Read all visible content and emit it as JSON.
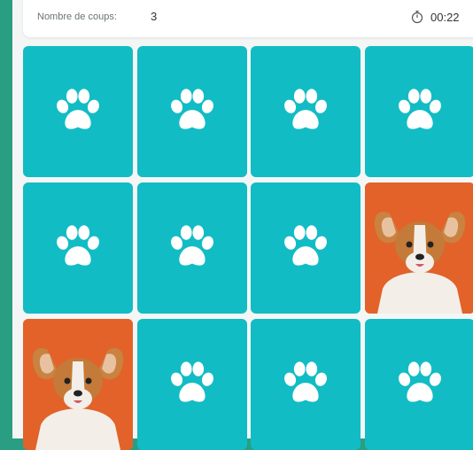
{
  "header": {
    "moves_label": "Nombre de coups:",
    "moves_value": "3",
    "timer_icon": "stopwatch-icon",
    "timer_value": "00:22"
  },
  "board": {
    "rows": 3,
    "cols": 4,
    "card_back_icon": "paw-icon",
    "card_back_color": "#12bcc4",
    "revealed_color": "#e2622a",
    "cards": [
      {
        "state": "hidden"
      },
      {
        "state": "hidden"
      },
      {
        "state": "hidden"
      },
      {
        "state": "hidden"
      },
      {
        "state": "hidden"
      },
      {
        "state": "hidden"
      },
      {
        "state": "hidden"
      },
      {
        "state": "revealed",
        "image": "corgi-puppy"
      },
      {
        "state": "revealed",
        "image": "corgi-puppy"
      },
      {
        "state": "hidden"
      },
      {
        "state": "hidden"
      },
      {
        "state": "hidden"
      }
    ]
  }
}
